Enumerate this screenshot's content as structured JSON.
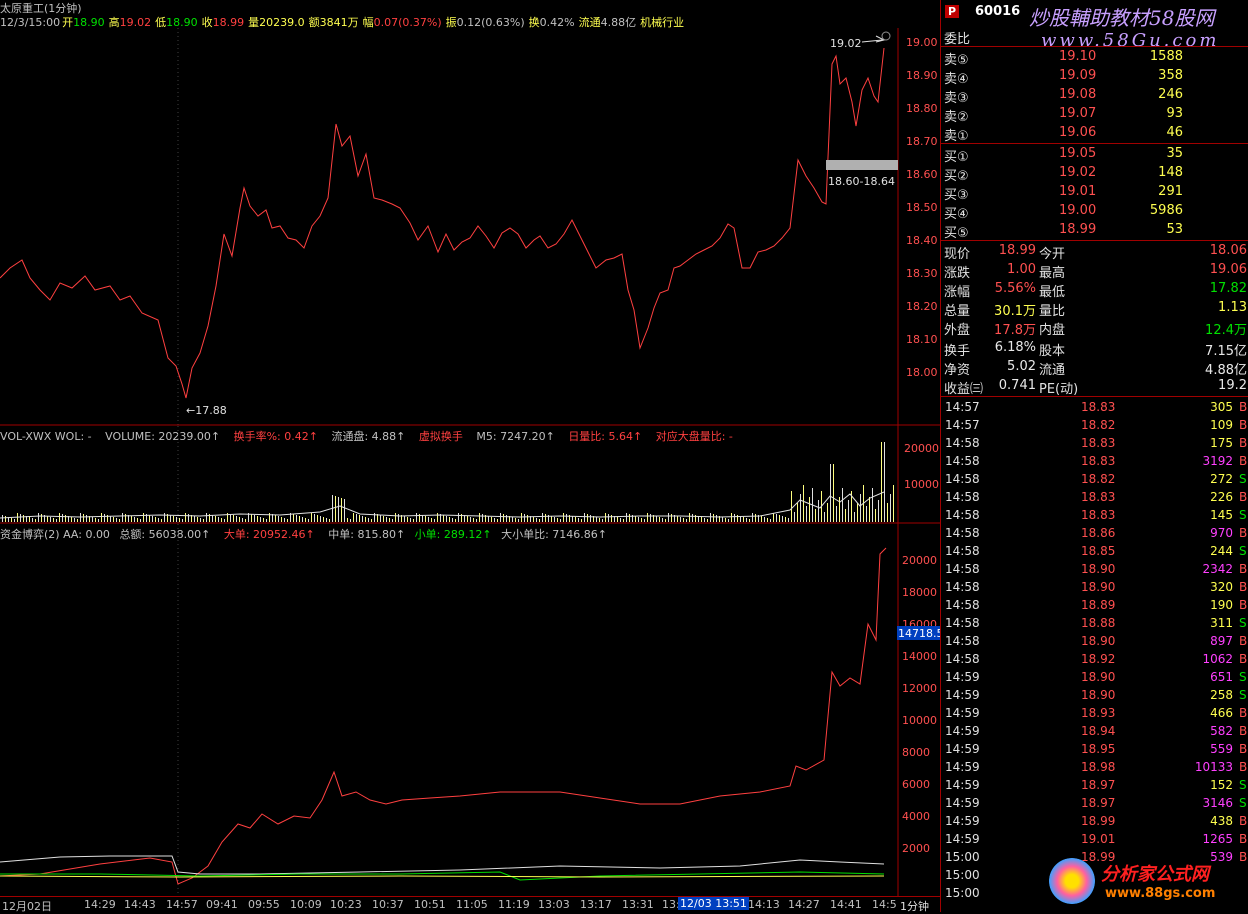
{
  "header": {
    "stock_title": "太原重工(1分钟)",
    "datetime": "12/3/15:00",
    "open_label": "开",
    "open": "18.90",
    "high_label": "高",
    "high": "19.02",
    "low_label": "低",
    "low": "18.90",
    "close_label": "收",
    "close": "18.99",
    "vol_label": "量",
    "vol": "20239.0",
    "amount_label": "额",
    "amount": "3841万",
    "chg_label": "幅",
    "chg": "0.07(0.37%)",
    "amp_label": "振",
    "amp": "0.12(0.63%)",
    "turn_label": "换",
    "turn": "0.42%",
    "float_label": "流通",
    "float": "4.88亿",
    "industry": "机械行业"
  },
  "price_chart": {
    "y_ticks": [
      "19.00",
      "18.90",
      "18.80",
      "18.70",
      "18.60",
      "18.50",
      "18.40",
      "18.30",
      "18.20",
      "18.10",
      "18.00"
    ],
    "high_annot": "19.02",
    "low_annot": "←17.88",
    "range_annot": "18.60-18.64",
    "color": "#ff4040"
  },
  "vol_panel": {
    "name": "VOL-XWX",
    "items": [
      {
        "text": "VOL-XWX WOL: -",
        "color": "#c0c0c0"
      },
      {
        "text": "VOLUME: 20239.00↑",
        "color": "#c0c0c0"
      },
      {
        "text": "换手率%: 0.42↑",
        "color": "#ff4040"
      },
      {
        "text": "流通盘: 4.88↑",
        "color": "#c0c0c0"
      },
      {
        "text": "虚拟换手",
        "color": "#ff4040"
      },
      {
        "text": "M5: 7247.20↑",
        "color": "#c0c0c0"
      },
      {
        "text": "日量比: 5.64↑",
        "color": "#ff4040"
      },
      {
        "text": "对应大盘量比: -",
        "color": "#ff4040"
      }
    ],
    "y_ticks": [
      "20000",
      "10000"
    ]
  },
  "fund_panel": {
    "items": [
      {
        "text": "资金博弈(2) AA: 0.00",
        "color": "#c0c0c0"
      },
      {
        "text": "总额: 56038.00↑",
        "color": "#c0c0c0"
      },
      {
        "text": "大单: 20952.46↑",
        "color": "#ff4040"
      },
      {
        "text": "中单: 815.80↑",
        "color": "#c0c0c0"
      },
      {
        "text": "小单: 289.12↑",
        "color": "#00e000"
      },
      {
        "text": "大小单比: 7146.86↑",
        "color": "#c0c0c0"
      }
    ],
    "y_ticks": [
      "20000",
      "18000",
      "16000",
      "14000",
      "12000",
      "10000",
      "8000",
      "6000",
      "4000",
      "2000"
    ],
    "current_value": "14718.5"
  },
  "x_axis": {
    "labels": [
      "12月02日",
      "14:29",
      "14:43",
      "14:57",
      "09:41",
      "09:55",
      "10:09",
      "10:23",
      "10:37",
      "10:51",
      "11:05",
      "11:19",
      "13:03",
      "13:17",
      "13:31",
      "13:",
      "12/03 13:51",
      "14:13",
      "14:27",
      "14:41",
      "14:5"
    ],
    "period": "1分钟"
  },
  "quote": {
    "code": "60016",
    "p_badge": "P",
    "weibi_label": "委比",
    "sells": [
      {
        "label": "卖⑤",
        "price": "19.10",
        "vol": "1588"
      },
      {
        "label": "卖④",
        "price": "19.09",
        "vol": "358"
      },
      {
        "label": "卖③",
        "price": "19.08",
        "vol": "246"
      },
      {
        "label": "卖②",
        "price": "19.07",
        "vol": "93"
      },
      {
        "label": "卖①",
        "price": "19.06",
        "vol": "46"
      }
    ],
    "buys": [
      {
        "label": "买①",
        "price": "19.05",
        "vol": "35"
      },
      {
        "label": "买②",
        "price": "19.02",
        "vol": "148"
      },
      {
        "label": "买③",
        "price": "19.01",
        "vol": "291"
      },
      {
        "label": "买④",
        "price": "19.00",
        "vol": "5986"
      },
      {
        "label": "买⑤",
        "price": "18.99",
        "vol": "53"
      }
    ],
    "stats": [
      {
        "l1": "现价",
        "v1": "18.99",
        "c1": "red",
        "l2": "今开",
        "v2": "18.06",
        "c2": "red"
      },
      {
        "l1": "涨跌",
        "v1": "1.00",
        "c1": "red",
        "l2": "最高",
        "v2": "19.06",
        "c2": "red"
      },
      {
        "l1": "涨幅",
        "v1": "5.56%",
        "c1": "red",
        "l2": "最低",
        "v2": "17.82",
        "c2": "grn"
      },
      {
        "l1": "总量",
        "v1": "30.1万",
        "c1": "yel",
        "l2": "量比",
        "v2": "1.13",
        "c2": "yel"
      },
      {
        "l1": "外盘",
        "v1": "17.8万",
        "c1": "red",
        "l2": "内盘",
        "v2": "12.4万",
        "c2": "grn"
      },
      {
        "l1": "换手",
        "v1": "6.18%",
        "c1": "wht",
        "l2": "股本",
        "v2": "7.15亿",
        "c2": "wht"
      },
      {
        "l1": "净资",
        "v1": "5.02",
        "c1": "wht",
        "l2": "流通",
        "v2": "4.88亿",
        "c2": "wht"
      },
      {
        "l1": "收益㈢",
        "v1": "0.741",
        "c1": "wht",
        "l2": "PE(动)",
        "v2": "19.2",
        "c2": "wht"
      }
    ]
  },
  "trades": [
    {
      "t": "14:57",
      "p": "18.83",
      "v": "305",
      "c": "yel",
      "s": "B"
    },
    {
      "t": "14:57",
      "p": "18.82",
      "v": "109",
      "c": "yel",
      "s": "B"
    },
    {
      "t": "14:58",
      "p": "18.83",
      "v": "175",
      "c": "yel",
      "s": "B"
    },
    {
      "t": "14:58",
      "p": "18.83",
      "v": "3192",
      "c": "mag",
      "s": "B"
    },
    {
      "t": "14:58",
      "p": "18.82",
      "v": "272",
      "c": "yel",
      "s": "S"
    },
    {
      "t": "14:58",
      "p": "18.83",
      "v": "226",
      "c": "yel",
      "s": "B"
    },
    {
      "t": "14:58",
      "p": "18.83",
      "v": "145",
      "c": "yel",
      "s": "S"
    },
    {
      "t": "14:58",
      "p": "18.86",
      "v": "970",
      "c": "mag",
      "s": "B"
    },
    {
      "t": "14:58",
      "p": "18.85",
      "v": "244",
      "c": "yel",
      "s": "S"
    },
    {
      "t": "14:58",
      "p": "18.90",
      "v": "2342",
      "c": "mag",
      "s": "B"
    },
    {
      "t": "14:58",
      "p": "18.90",
      "v": "320",
      "c": "yel",
      "s": "B"
    },
    {
      "t": "14:58",
      "p": "18.89",
      "v": "190",
      "c": "yel",
      "s": "B"
    },
    {
      "t": "14:58",
      "p": "18.88",
      "v": "311",
      "c": "yel",
      "s": "S"
    },
    {
      "t": "14:58",
      "p": "18.90",
      "v": "897",
      "c": "mag",
      "s": "B"
    },
    {
      "t": "14:58",
      "p": "18.92",
      "v": "1062",
      "c": "mag",
      "s": "B"
    },
    {
      "t": "14:59",
      "p": "18.90",
      "v": "651",
      "c": "mag",
      "s": "S"
    },
    {
      "t": "14:59",
      "p": "18.90",
      "v": "258",
      "c": "yel",
      "s": "S"
    },
    {
      "t": "14:59",
      "p": "18.93",
      "v": "466",
      "c": "yel",
      "s": "B"
    },
    {
      "t": "14:59",
      "p": "18.94",
      "v": "582",
      "c": "mag",
      "s": "B"
    },
    {
      "t": "14:59",
      "p": "18.95",
      "v": "559",
      "c": "mag",
      "s": "B"
    },
    {
      "t": "14:59",
      "p": "18.98",
      "v": "10133",
      "c": "mag",
      "s": "B"
    },
    {
      "t": "14:59",
      "p": "18.97",
      "v": "152",
      "c": "yel",
      "s": "S"
    },
    {
      "t": "14:59",
      "p": "18.97",
      "v": "3146",
      "c": "mag",
      "s": "S"
    },
    {
      "t": "14:59",
      "p": "18.99",
      "v": "438",
      "c": "yel",
      "s": "B"
    },
    {
      "t": "14:59",
      "p": "19.01",
      "v": "1265",
      "c": "mag",
      "s": "B"
    },
    {
      "t": "15:00",
      "p": "18.99",
      "v": "539",
      "c": "mag",
      "s": "B"
    },
    {
      "t": "15:00",
      "p": "",
      "v": "",
      "c": "yel",
      "s": ""
    },
    {
      "t": "15:00",
      "p": "",
      "v": "",
      "c": "yel",
      "s": ""
    }
  ],
  "watermarks": {
    "top_cn": "炒股輔助教材58股网",
    "top_url": "www.58Gu.com",
    "bottom_cn": "分析家公式网",
    "bottom_url": "www.88gs.com"
  }
}
